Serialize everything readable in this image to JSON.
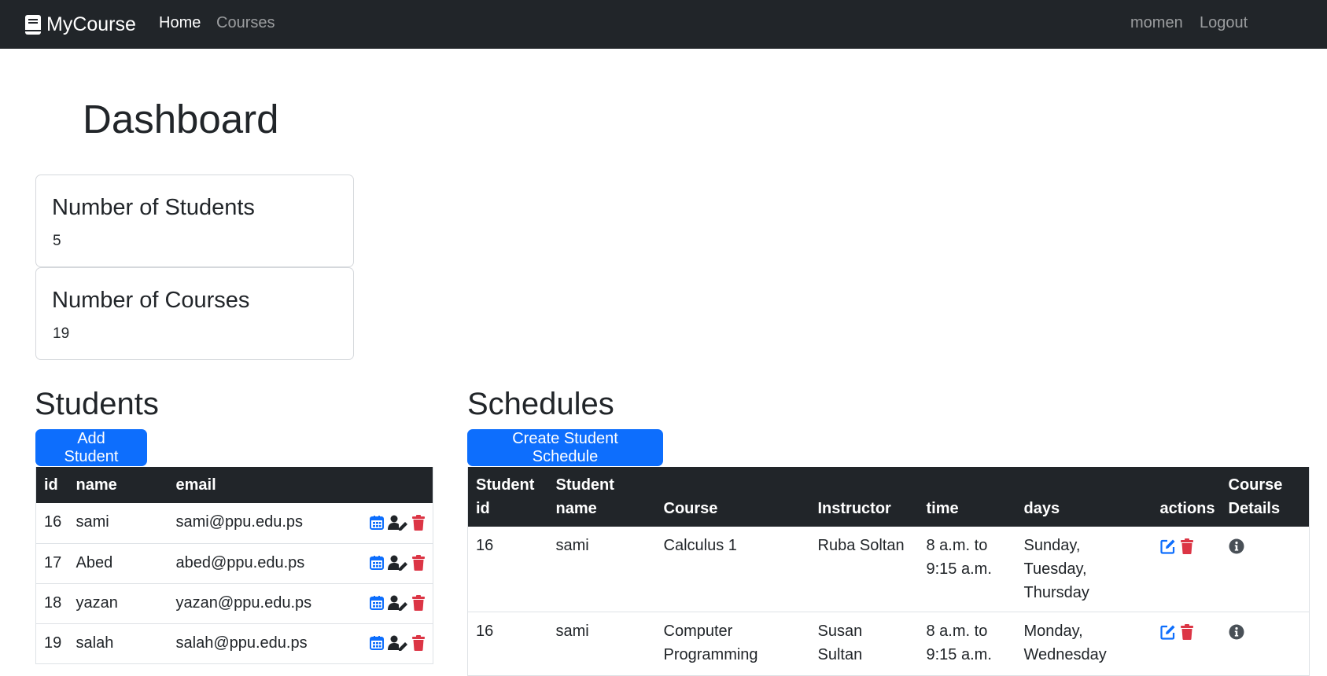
{
  "navbar": {
    "brand": "MyCourse",
    "brand_icon": "book-icon",
    "links": [
      {
        "label": "Home",
        "active": true
      },
      {
        "label": "Courses",
        "active": false
      }
    ],
    "user": "momen",
    "logout": "Logout"
  },
  "page_title": "Dashboard",
  "cards": [
    {
      "title": "Number of Students",
      "value": "5"
    },
    {
      "title": "Number of Courses",
      "value": "19"
    }
  ],
  "students": {
    "title": "Students",
    "add_button": "Add Student",
    "columns": [
      "id",
      "name",
      "email",
      ""
    ],
    "rows": [
      {
        "id": "16",
        "name": "sami",
        "email": "sami@ppu.edu.ps"
      },
      {
        "id": "17",
        "name": "Abed",
        "email": "abed@ppu.edu.ps"
      },
      {
        "id": "18",
        "name": "yazan",
        "email": "yazan@ppu.edu.ps"
      },
      {
        "id": "19",
        "name": "salah",
        "email": "salah@ppu.edu.ps"
      }
    ],
    "row_icons": [
      "calendar-icon",
      "user-edit-icon",
      "trash-icon"
    ]
  },
  "schedules": {
    "title": "Schedules",
    "create_button": "Create Student Schedule",
    "columns": [
      "Student id",
      "Student name",
      "Course",
      "Instructor",
      "time",
      "days",
      "actions",
      "Course Details"
    ],
    "rows": [
      {
        "student_id": "16",
        "student_name": "sami",
        "course": "Calculus 1",
        "instructor": "Ruba Soltan",
        "time": "8 a.m. to 9:15 a.m.",
        "days": "Sunday, Tuesday, Thursday"
      },
      {
        "student_id": "16",
        "student_name": "sami",
        "course": "Computer Programming",
        "instructor": "Susan Sultan",
        "time": "8 a.m. to 9:15 a.m.",
        "days": "Monday, Wednesday"
      }
    ],
    "row_icons": [
      "edit-icon",
      "trash-icon",
      "info-icon"
    ]
  },
  "colors": {
    "navbar_bg": "#212529",
    "primary": "#0d6efd",
    "danger": "#dc3545",
    "info_icon": "#495057"
  }
}
